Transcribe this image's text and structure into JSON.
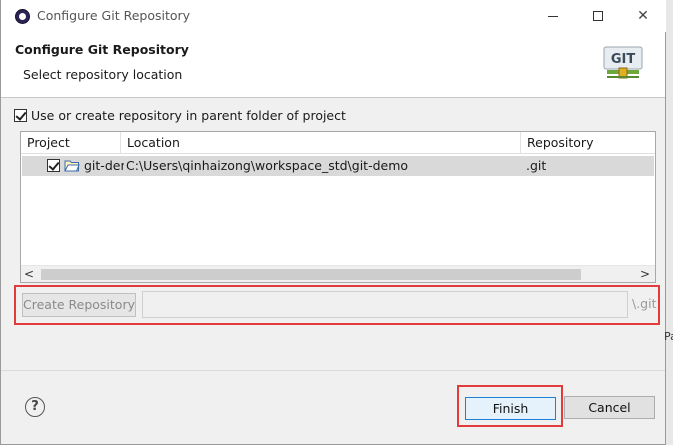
{
  "window": {
    "title": "Configure Git Repository"
  },
  "header": {
    "title": "Configure Git Repository",
    "description": "Select repository location",
    "logo_text": "GIT"
  },
  "options": {
    "use_parent_label": "Use or create repository in parent folder of project",
    "use_parent_checked": true
  },
  "table": {
    "columns": [
      "Project",
      "Location",
      "Repository"
    ],
    "rows": [
      {
        "checked": true,
        "project": "git-demo",
        "location": "C:\\Users\\qinhaizong\\workspace_std\\git-demo",
        "repository": ".git"
      }
    ],
    "scroll_left": "<",
    "scroll_right": ">"
  },
  "create": {
    "button_label": "Create Repository",
    "path_value": "",
    "suffix": "\\.git"
  },
  "footer": {
    "help": "?",
    "finish_label": "Finish",
    "cancel_label": "Cancel"
  },
  "background": {
    "edge_text": "Pa"
  },
  "colors": {
    "highlight_frame": "#e23b3b",
    "default_button_border": "#1e7fd7",
    "row_selected": "#d9d9d9"
  }
}
